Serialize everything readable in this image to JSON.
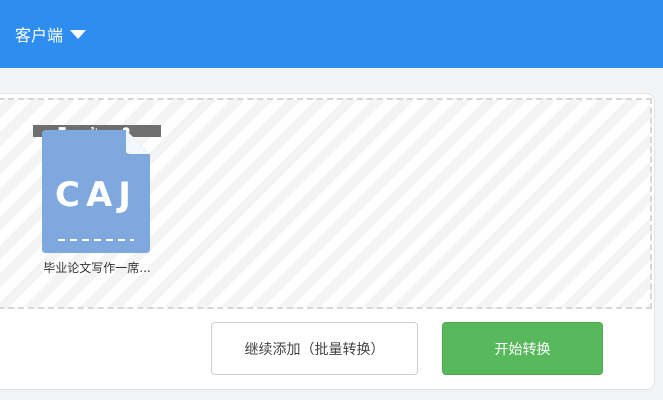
{
  "header": {
    "client_menu_label": "客户端",
    "color": "#2d8ef0"
  },
  "file": {
    "badge_text": "CAJ",
    "name": "毕业论文写作一席...",
    "icon": "caj-file-icon",
    "toolbar_icons": [
      "delete-icon",
      "rotate-icon",
      "preview-icon"
    ],
    "icon_color": "#7fa8de"
  },
  "actions": {
    "continue_label": "继续添加（批量转换）",
    "start_label": "开始转换",
    "start_color": "#58b85c"
  }
}
